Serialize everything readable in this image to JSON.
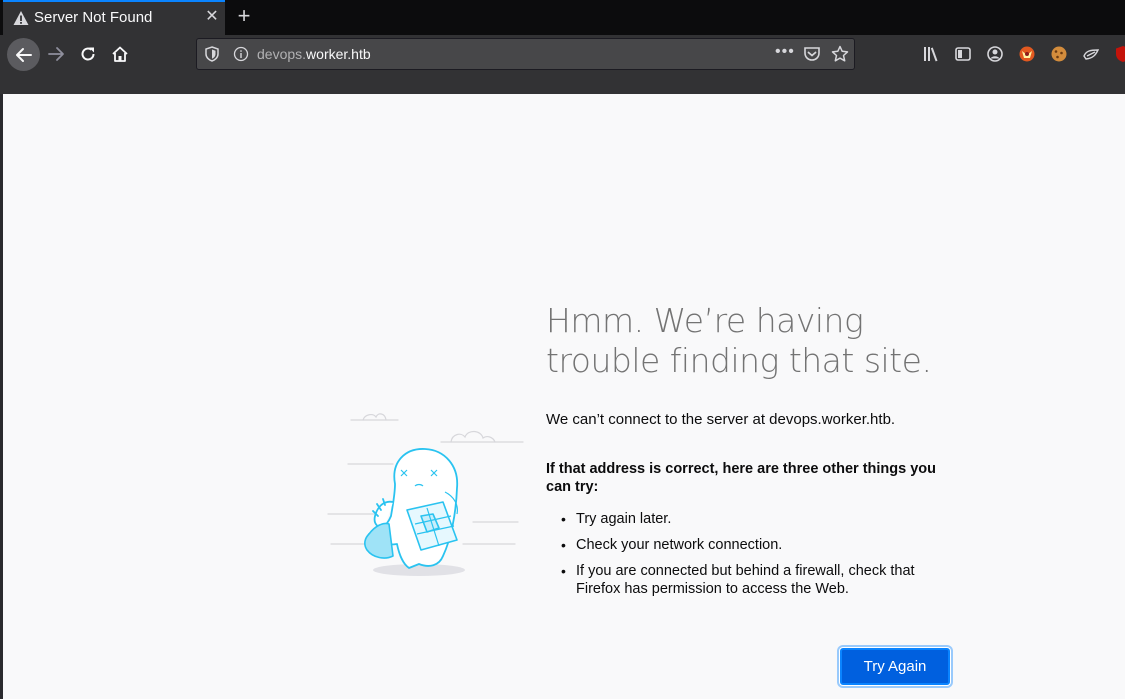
{
  "browser": {
    "tab": {
      "title": "Server Not Found"
    },
    "url": {
      "prefix": "devops.",
      "host": "worker.htb"
    }
  },
  "page": {
    "title_part1": "Hmm",
    "title_part2": ". We’re having trouble finding that site",
    "title_part3": ".",
    "description": "We can’t connect to the server at devops.worker.htb.",
    "subheading": "If that address is correct, here are three other things you can try:",
    "tips": [
      "Try again later.",
      "Check your network connection.",
      "If you are connected but behind a firewall, check that Firefox has permission to access the Web."
    ],
    "try_again_label": "Try Again"
  },
  "colors": {
    "accent": "#0a84ff",
    "button": "#0060df",
    "illustration": "#2ac3f0"
  }
}
